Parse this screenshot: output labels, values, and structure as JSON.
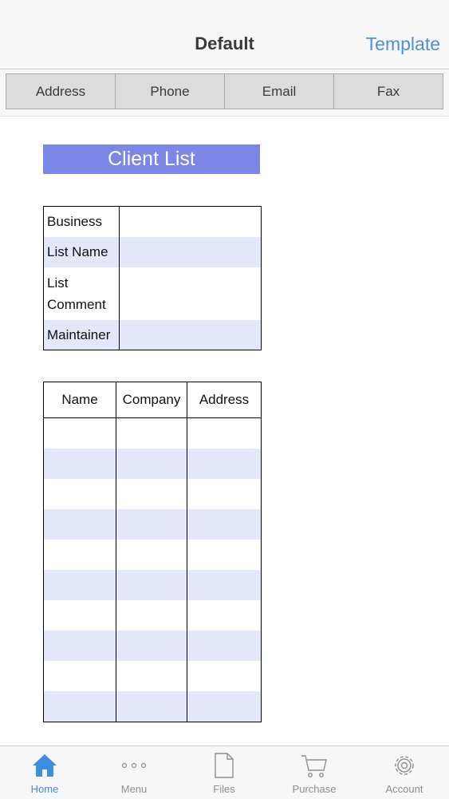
{
  "navbar": {
    "title": "Default",
    "right_action": "Template"
  },
  "segments": [
    "Address",
    "Phone",
    "Email",
    "Fax"
  ],
  "document": {
    "title": "Client List",
    "info_fields": [
      {
        "label": "Business",
        "value": ""
      },
      {
        "label": "List Name",
        "value": ""
      },
      {
        "label": "List Comment",
        "value": ""
      },
      {
        "label": "Maintainer",
        "value": ""
      }
    ],
    "table_headers": [
      "Name",
      "Company",
      "Address"
    ]
  },
  "tabbar": {
    "tabs": [
      {
        "label": "Home",
        "icon": "home-icon"
      },
      {
        "label": "Menu",
        "icon": "more-icon"
      },
      {
        "label": "Files",
        "icon": "file-icon"
      },
      {
        "label": "Purchase",
        "icon": "cart-icon"
      },
      {
        "label": "Account",
        "icon": "gear-icon"
      }
    ]
  },
  "colors": {
    "accent": "#3c8ee0",
    "title_fill": "#7b86e6",
    "row_shade": "#e4e6fa"
  }
}
